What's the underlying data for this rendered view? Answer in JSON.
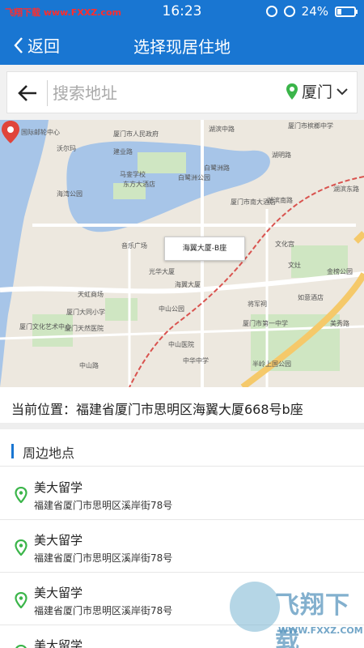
{
  "status_bar": {
    "watermark_site": "飞翔下载",
    "watermark_url": "www.FXXZ.com",
    "time": "16:23",
    "battery_text": "24%",
    "battery_level_percent": 24
  },
  "nav": {
    "back_label": "返回",
    "title": "选择现居住地"
  },
  "search": {
    "placeholder": "搜索地址",
    "city": "厦门"
  },
  "map": {
    "callout": "海翼大厦-B座",
    "labels": [
      "国际邮轮中心",
      "厦门市人民政府",
      "湖滨中路",
      "厦门市槟榔中学",
      "沃尔玛",
      "建业路",
      "马銮学校",
      "东方大酒店",
      "白鹭洲路",
      "湖明路",
      "白鹭洲公园",
      "海湾公园",
      "湖滨南路",
      "厦门市南大酒店",
      "音乐广场",
      "文化宫",
      "光华大厦",
      "海翼大厦",
      "厦门市第一中学",
      "天虹商场",
      "中山公园",
      "将军祠",
      "中山医院",
      "中山路",
      "厦门大同小学",
      "厦门文化艺术中心",
      "文灶",
      "如意酒店",
      "湖滨东路",
      "厦门天然医院",
      "中华中学",
      "半岭上国公园",
      "金榜公园",
      "美秀路"
    ]
  },
  "current_location": {
    "text": "当前位置：福建省厦门市思明区海翼大厦668号b座"
  },
  "nearby": {
    "title": "周边地点",
    "items": [
      {
        "name": "美大留学",
        "address": "福建省厦门市思明区溪岸街78号"
      },
      {
        "name": "美大留学",
        "address": "福建省厦门市思明区溪岸街78号"
      },
      {
        "name": "美大留学",
        "address": "福建省厦门市思明区溪岸街78号"
      },
      {
        "name": "美大留学",
        "address": ""
      }
    ]
  },
  "footer_watermark": {
    "brand": "飞翔下载",
    "site": "WWW.FXXZ.COM"
  },
  "colors": {
    "primary": "#1976d2",
    "pin_green": "#3bb54a",
    "map_water": "#a7c5e8",
    "map_land": "#ede8df"
  }
}
